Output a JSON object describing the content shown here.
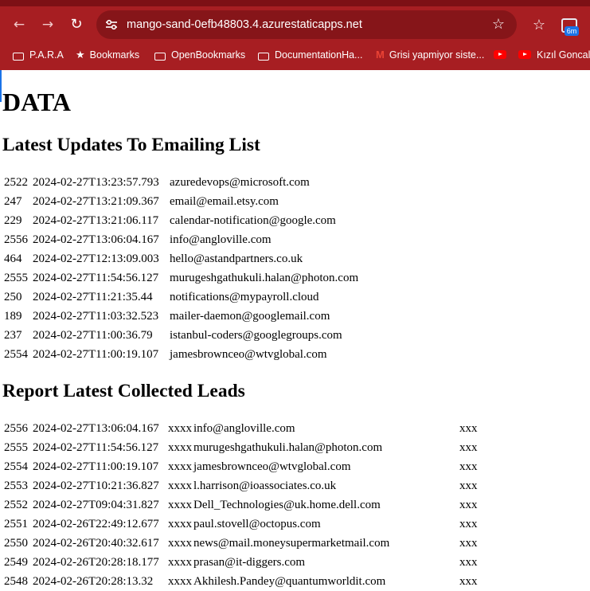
{
  "browser": {
    "url": "mango-sand-0efb48803.4.azurestaticapps.net",
    "extension_badge": "6m",
    "bookmarks": [
      {
        "label": "P.A.R.A",
        "icon": "folder-icon"
      },
      {
        "label": "Bookmarks",
        "icon": "star-icon"
      },
      {
        "label": "OpenBookmarks",
        "icon": "folder-icon"
      },
      {
        "label": "DocumentationHa...",
        "icon": "folder-icon"
      },
      {
        "label": "Grisi yapmiyor siste...",
        "icon": "gmail-icon"
      },
      {
        "label": "",
        "icon": "youtube-icon"
      },
      {
        "label": "Kızıl Goncala",
        "icon": "youtube-icon"
      }
    ]
  },
  "page": {
    "title": "DATA",
    "emailing_section": {
      "heading": "Latest Updates To Emailing List",
      "rows": [
        {
          "id": "2522",
          "timestamp": "2024-02-27T13:23:57.793",
          "email": "azuredevops@microsoft.com"
        },
        {
          "id": "247",
          "timestamp": "2024-02-27T13:21:09.367",
          "email": "email@email.etsy.com"
        },
        {
          "id": "229",
          "timestamp": "2024-02-27T13:21:06.117",
          "email": "calendar-notification@google.com"
        },
        {
          "id": "2556",
          "timestamp": "2024-02-27T13:06:04.167",
          "email": "info@angloville.com"
        },
        {
          "id": "464",
          "timestamp": "2024-02-27T12:13:09.003",
          "email": "hello@astandpartners.co.uk"
        },
        {
          "id": "2555",
          "timestamp": "2024-02-27T11:54:56.127",
          "email": "murugeshgathukuli.halan@photon.com"
        },
        {
          "id": "250",
          "timestamp": "2024-02-27T11:21:35.44",
          "email": "notifications@mypayroll.cloud"
        },
        {
          "id": "189",
          "timestamp": "2024-02-27T11:03:32.523",
          "email": "mailer-daemon@googlemail.com"
        },
        {
          "id": "237",
          "timestamp": "2024-02-27T11:00:36.79",
          "email": "istanbul-coders@googlegroups.com"
        },
        {
          "id": "2554",
          "timestamp": "2024-02-27T11:00:19.107",
          "email": "jamesbrownceo@wtvglobal.com"
        }
      ]
    },
    "leads_section": {
      "heading": "Report Latest Collected Leads",
      "rows": [
        {
          "id": "2556",
          "timestamp": "2024-02-27T13:06:04.167",
          "mask": "xxxx",
          "email": "info@angloville.com",
          "extra": "xxx"
        },
        {
          "id": "2555",
          "timestamp": "2024-02-27T11:54:56.127",
          "mask": "xxxx",
          "email": "murugeshgathukuli.halan@photon.com",
          "extra": "xxx"
        },
        {
          "id": "2554",
          "timestamp": "2024-02-27T11:00:19.107",
          "mask": "xxxx",
          "email": "jamesbrownceo@wtvglobal.com",
          "extra": "xxx"
        },
        {
          "id": "2553",
          "timestamp": "2024-02-27T10:21:36.827",
          "mask": "xxxx",
          "email": "l.harrison@ioassociates.co.uk",
          "extra": "xxx"
        },
        {
          "id": "2552",
          "timestamp": "2024-02-27T09:04:31.827",
          "mask": "xxxx",
          "email": "Dell_Technologies@uk.home.dell.com",
          "extra": "xxx"
        },
        {
          "id": "2551",
          "timestamp": "2024-02-26T22:49:12.677",
          "mask": "xxxx",
          "email": "paul.stovell@octopus.com",
          "extra": "xxx"
        },
        {
          "id": "2550",
          "timestamp": "2024-02-26T20:40:32.617",
          "mask": "xxxx",
          "email": "news@mail.moneysupermarketmail.com",
          "extra": "xxx"
        },
        {
          "id": "2549",
          "timestamp": "2024-02-26T20:28:18.177",
          "mask": "xxxx",
          "email": "prasan@it-diggers.com",
          "extra": "xxx"
        },
        {
          "id": "2548",
          "timestamp": "2024-02-26T20:28:13.32",
          "mask": "xxxx",
          "email": "Akhilesh.Pandey@quantumworldit.com",
          "extra": "xxx"
        }
      ]
    }
  }
}
